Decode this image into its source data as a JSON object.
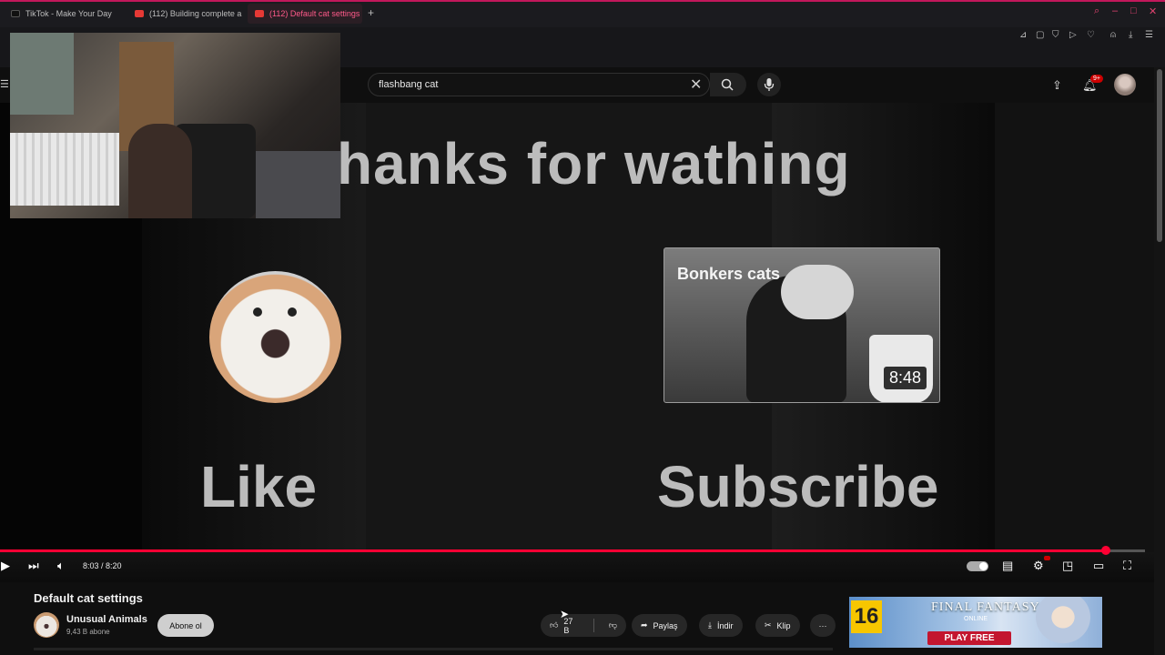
{
  "browser": {
    "tabs": [
      {
        "label": "TikTok - Make Your Day"
      },
      {
        "label": "(112) Building complete a"
      },
      {
        "label": "(112) Default cat settings"
      }
    ],
    "new_tab": "+"
  },
  "search": {
    "query": "flashbang cat",
    "notif_count": "9+"
  },
  "endscreen": {
    "title": "hanks for wathing",
    "like": "Like",
    "subscribe": "Subscribe",
    "card_title": "Bonkers cats",
    "card_duration": "8:48"
  },
  "player": {
    "time": "8:03 / 8:20",
    "progress": 0.966
  },
  "video": {
    "title": "Default cat settings",
    "channel": "Unusual Animals",
    "subs": "9,43 B abone",
    "subscribe_label": "Abone ol",
    "likes": "27 B",
    "share": "Paylaş",
    "download": "İndir",
    "clip": "Klip",
    "more": "···"
  },
  "ad": {
    "rating": "16",
    "logo": "FINAL FANTASY XIV",
    "sub": "ONLINE",
    "cta": "PLAY FREE"
  },
  "colors": {
    "accent": "#ff0033",
    "browser_accent": "#e0436f"
  }
}
